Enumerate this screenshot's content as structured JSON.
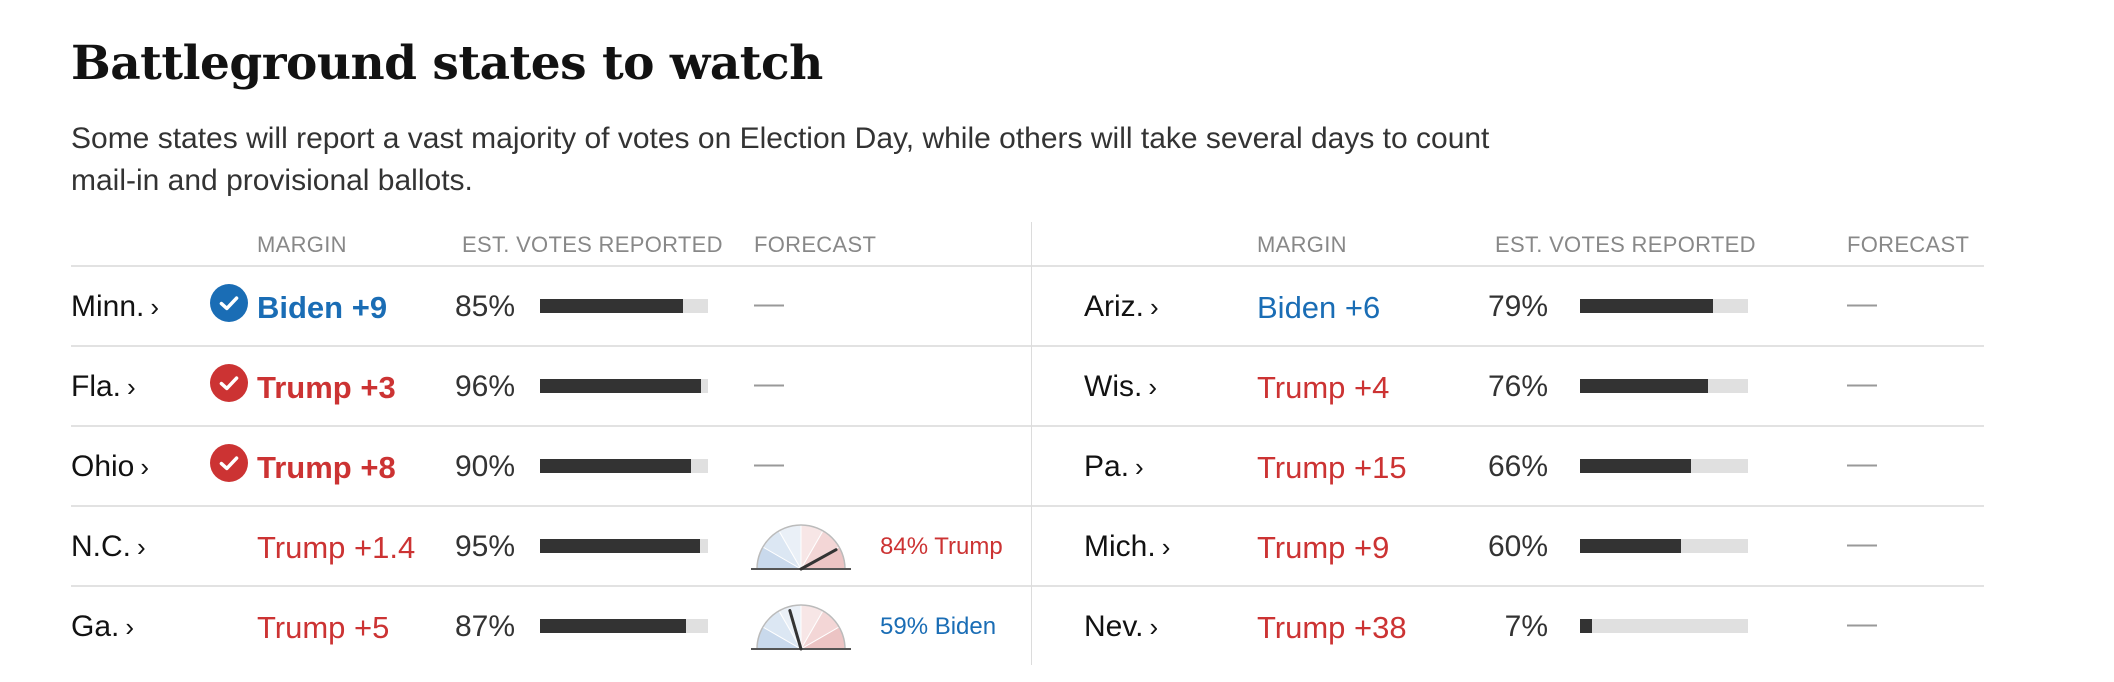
{
  "title": "Battleground states to watch",
  "subtitle": "Some states will report a vast majority of votes on Election Day, while others will take several days to count mail-in and provisional ballots.",
  "headers": {
    "margin": "MARGIN",
    "votes": "EST. VOTES REPORTED",
    "forecast": "FORECAST"
  },
  "colors": {
    "dem": "#1a6db5",
    "rep": "#cc3333",
    "bar": "#333333",
    "bar_bg": "#e0e0e0"
  },
  "left_states": [
    {
      "state": "Minn.",
      "margin": "Biden +9",
      "party": "dem",
      "called": true,
      "reported": "85%",
      "reported_value": 85,
      "forecast": "—",
      "forecast_label": ""
    },
    {
      "state": "Fla.",
      "margin": "Trump +3",
      "party": "rep",
      "called": true,
      "reported": "96%",
      "reported_value": 96,
      "forecast": "—",
      "forecast_label": ""
    },
    {
      "state": "Ohio",
      "margin": "Trump +8",
      "party": "rep",
      "called": true,
      "reported": "90%",
      "reported_value": 90,
      "forecast": "—",
      "forecast_label": ""
    },
    {
      "state": "N.C.",
      "margin": "Trump +1.4",
      "party": "rep",
      "called": false,
      "reported": "95%",
      "reported_value": 95,
      "forecast": "",
      "forecast_label": "84% Trump",
      "forecast_party": "rep",
      "forecast_value": 84
    },
    {
      "state": "Ga.",
      "margin": "Trump +5",
      "party": "rep",
      "called": false,
      "reported": "87%",
      "reported_value": 87,
      "forecast": "",
      "forecast_label": "59% Biden",
      "forecast_party": "dem",
      "forecast_value": 59
    }
  ],
  "right_states": [
    {
      "state": "Ariz.",
      "margin": "Biden +6",
      "party": "dem",
      "called": false,
      "reported": "79%",
      "reported_value": 79,
      "forecast": "—"
    },
    {
      "state": "Wis.",
      "margin": "Trump +4",
      "party": "rep",
      "called": false,
      "reported": "76%",
      "reported_value": 76,
      "forecast": "—"
    },
    {
      "state": "Pa.",
      "margin": "Trump +15",
      "party": "rep",
      "called": false,
      "reported": "66%",
      "reported_value": 66,
      "forecast": "—"
    },
    {
      "state": "Mich.",
      "margin": "Trump +9",
      "party": "rep",
      "called": false,
      "reported": "60%",
      "reported_value": 60,
      "forecast": "—"
    },
    {
      "state": "Nev.",
      "margin": "Trump +38",
      "party": "rep",
      "called": false,
      "reported": "7%",
      "reported_value": 7,
      "forecast": "—"
    }
  ]
}
